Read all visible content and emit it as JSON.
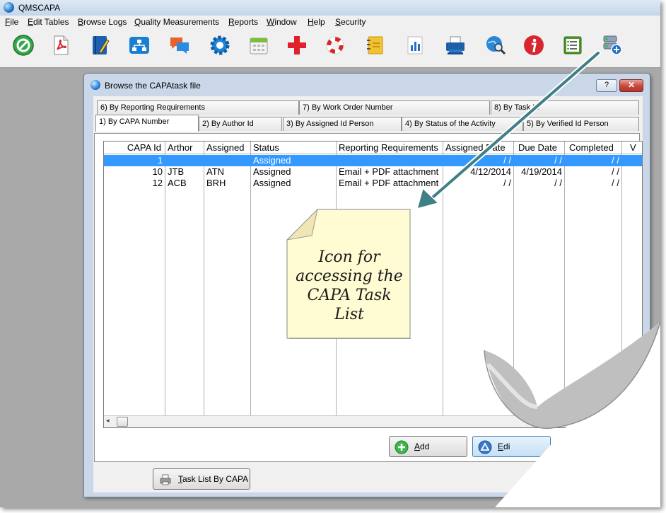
{
  "window": {
    "title": "QMSCAPA"
  },
  "menu": [
    "File",
    "Edit Tables",
    "Browse Logs",
    "Quality Measurements",
    "Reports",
    "Window",
    "Help",
    "Security"
  ],
  "toolbar_icons": [
    "cancel-icon",
    "acrobat-document-icon",
    "edit-notebook-icon",
    "org-chart-icon",
    "chat-bubbles-icon",
    "settings-gear-icon",
    "calendar-icon",
    "red-cross-icon",
    "lifebuoy-icon",
    "sticky-notes-icon",
    "bar-chart-icon",
    "printer-icon",
    "web-search-icon",
    "info-icon",
    "task-list-icon",
    "settings-add-icon"
  ],
  "dialog": {
    "title": "Browse the CAPAtask file",
    "help_label": "?",
    "close_label": "✕",
    "tabs_back": [
      "6) By Reporting Requirements",
      "7) By Work Order Number",
      "8) By Task Id"
    ],
    "tabs_front": [
      "1) By CAPA Number",
      "2) By Author Id",
      "3) By Assigned Id Person",
      "4) By Status of the Activity",
      "5) By Verified Id Person"
    ],
    "active_tab": "1) By CAPA Number"
  },
  "grid": {
    "columns": [
      "CAPA Id",
      "Arthor",
      "Assigned",
      "Status",
      "Reporting Requirements",
      "Assigned Date",
      "Due Date",
      "Completed",
      "V"
    ],
    "rows": [
      [
        "1",
        "",
        "",
        "Assigned",
        "",
        "/ /",
        "/ /",
        "/ /",
        ""
      ],
      [
        "10",
        "JTB",
        "ATN",
        "Assigned",
        "Email + PDF attachment",
        "4/12/2014",
        "4/19/2014",
        "/ /",
        ""
      ],
      [
        "12",
        "ACB",
        "BRH",
        "Assigned",
        "Email + PDF attachment",
        "/ /",
        "/ /",
        "/ /",
        ""
      ]
    ],
    "selected_row": 0
  },
  "buttons": {
    "add": "Add",
    "edit": "Edi",
    "task_list": "Task List By CAPA"
  },
  "callout": {
    "note_text": [
      "Icon for",
      "accessing the",
      "CAPA Task",
      "List"
    ]
  },
  "colors": {
    "selection": "#3399ff",
    "note": "#fffbd3",
    "arrow": "#3f7f86"
  }
}
